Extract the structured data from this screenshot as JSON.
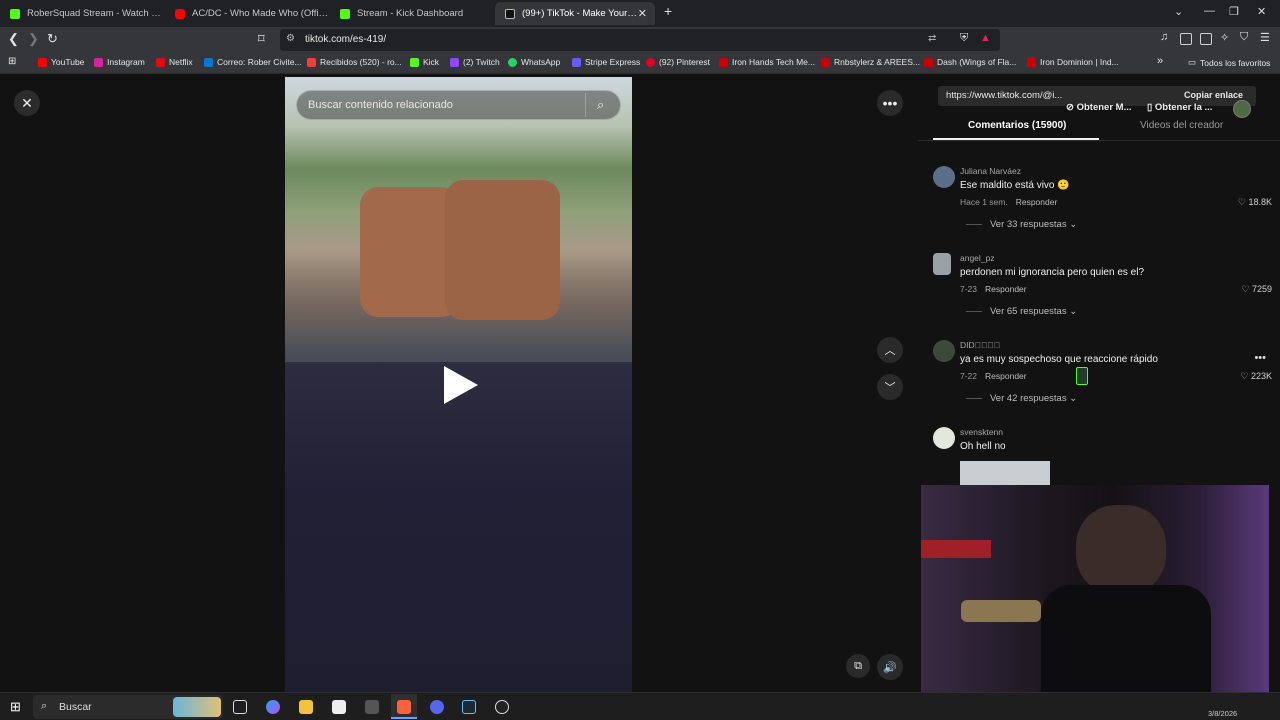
{
  "browser": {
    "tabs": [
      {
        "label": "RoberSquad Stream - Watch Live",
        "icon": "kick-icon"
      },
      {
        "label": "AC/DC - Who Made Who (Official HD",
        "icon": "youtube-icon"
      },
      {
        "label": "Stream - Kick Dashboard",
        "icon": "kick-icon"
      },
      {
        "label": "(99+) TikTok - Make Your Day",
        "icon": "tiktok-icon",
        "active": true
      }
    ],
    "new_tab": "+",
    "url": "tiktok.com/es-419/",
    "bookmarks": [
      {
        "label": "YouTube",
        "color": "#ff0000"
      },
      {
        "label": "Instagram",
        "color": "#d6249f"
      },
      {
        "label": "Netflix",
        "color": "#e50914"
      },
      {
        "label": "Correo: Rober Civite...",
        "color": "#0078d4"
      },
      {
        "label": "Recibidos (520) - ro...",
        "color": "#ea4335"
      },
      {
        "label": "Kick",
        "color": "#53fc18"
      },
      {
        "label": "(2) Twitch",
        "color": "#9146ff"
      },
      {
        "label": "WhatsApp",
        "color": "#25d366"
      },
      {
        "label": "Stripe Express",
        "color": "#635bff"
      },
      {
        "label": "(92) Pinterest",
        "color": "#e60023"
      },
      {
        "label": "Iron Hands Tech Me...",
        "color": "#cc0000"
      },
      {
        "label": "Rnbstylerz & AREES...",
        "color": "#cc0000"
      },
      {
        "label": "Dash (Wings of Fla...",
        "color": "#cc0000"
      },
      {
        "label": "Iron Dominion | Ind...",
        "color": "#cc0000"
      }
    ],
    "bookmarks_more": "»",
    "all_favorites": "Todos los favoritos"
  },
  "video": {
    "search_placeholder": "Buscar contenido relacionado"
  },
  "panel": {
    "link": "https://www.tiktok.com/@i...",
    "copy_link": "Copiar enlace",
    "get_m": "Obtener M...",
    "get_la": "Obtener la ...",
    "tab_comments": "Comentarios (15900)",
    "tab_creator_videos": "Videos del creador",
    "comments": [
      {
        "user": "Juliana Narváez",
        "text": "Ese maldito está vivo 🙂",
        "time": "Hace 1 sem.",
        "reply": "Responder",
        "likes": "18.8K",
        "more": "Ver 33 respuestas",
        "avatar_color": "#5a6e8a"
      },
      {
        "user": "angel_pz",
        "text": "perdonen mi ignorancia pero quien es el?",
        "time": "7-23",
        "reply": "Responder",
        "likes": "7259",
        "more": "Ver 65 respuestas",
        "avatar_color": "#9aa0a6"
      },
      {
        "user": "DID⌁⃝⃝⃝",
        "text": "ya es muy sospechoso que reaccione rápido",
        "time": "7-22",
        "reply": "Responder",
        "likes": "223K",
        "more": "Ver 42 respuestas",
        "avatar_color": "#3c4a3a"
      },
      {
        "user": "svensktenn",
        "text": "Oh hell no",
        "time": "",
        "reply": "",
        "likes": "",
        "more": "",
        "avatar_color": "#8ab04a"
      }
    ]
  },
  "taskbar": {
    "search": "Buscar",
    "clock": "3/8/2026"
  }
}
